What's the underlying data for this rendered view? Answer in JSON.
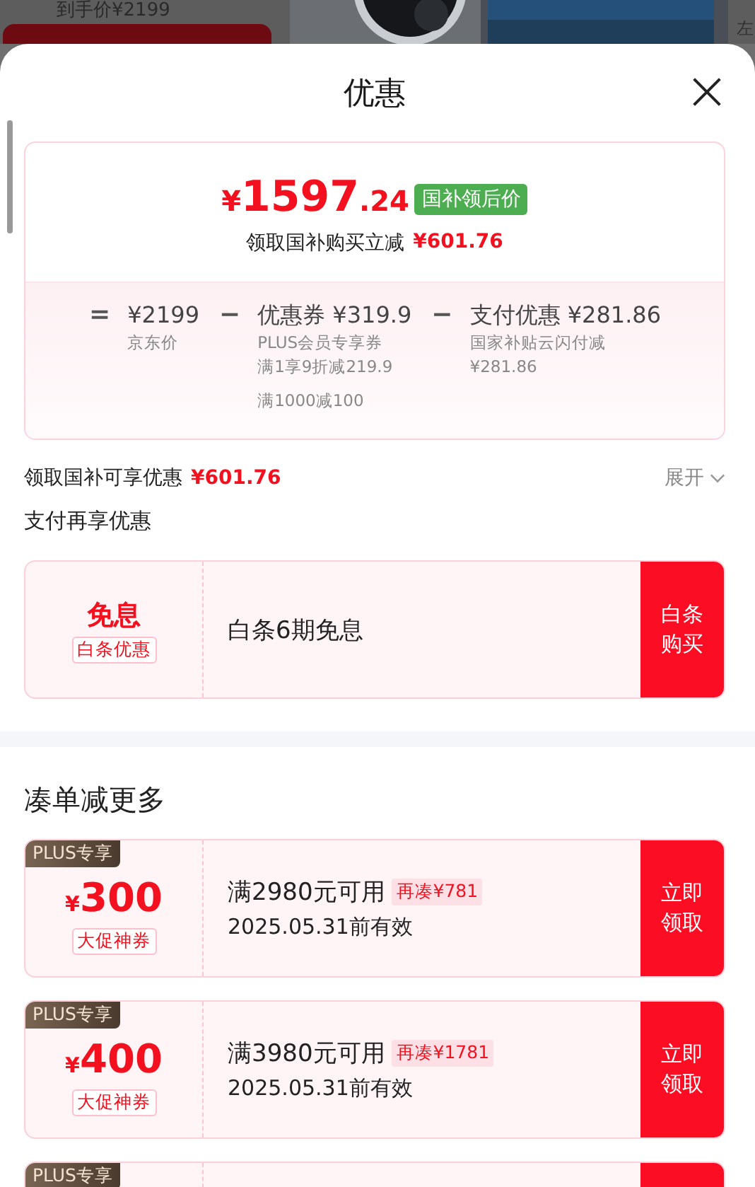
{
  "backdrop": {
    "price": "到手价¥2199",
    "side_text": "左"
  },
  "sheet": {
    "title": "优惠"
  },
  "summary": {
    "price_symbol": "¥",
    "price_int": "1597",
    "price_dec": ".24",
    "badge": "国补领后价",
    "subtitle": "领取国补购买立减",
    "subtitle_amount": "¥601.76",
    "terms": [
      {
        "op": "=",
        "value": "¥2199",
        "notes": [
          "京东价"
        ]
      },
      {
        "op": "−",
        "value": "优惠券 ¥319.9",
        "notes": [
          "PLUS会员专享券",
          "满1享9折减219.9",
          "满1000减100"
        ]
      },
      {
        "op": "−",
        "value": "支付优惠 ¥281.86",
        "notes": [
          "国家补贴云闪付减",
          "¥281.86"
        ]
      }
    ]
  },
  "subsidy_row": {
    "label": "领取国补可享优惠",
    "amount": "¥601.76",
    "toggle": "展开",
    "expanded": false
  },
  "pay_section": {
    "title": "支付再享优惠",
    "card": {
      "big": "免息",
      "tag": "白条优惠",
      "desc": "白条6期免息",
      "button": "白条购买"
    }
  },
  "more_section": {
    "title": "凑单减更多",
    "coupons": [
      {
        "tag": "PLUS专享",
        "symbol": "¥",
        "amount": "300",
        "label": "大促神券",
        "condition": "满2980元可用",
        "gap": "再凑¥781",
        "validity": "2025.05.31前有效",
        "button": "立即领取"
      },
      {
        "tag": "PLUS专享",
        "symbol": "¥",
        "amount": "400",
        "label": "大促神券",
        "condition": "满3980元可用",
        "gap": "再凑¥1781",
        "validity": "2025.05.31前有效",
        "button": "立即领取"
      },
      {
        "tag": "PLUS专享"
      }
    ]
  }
}
